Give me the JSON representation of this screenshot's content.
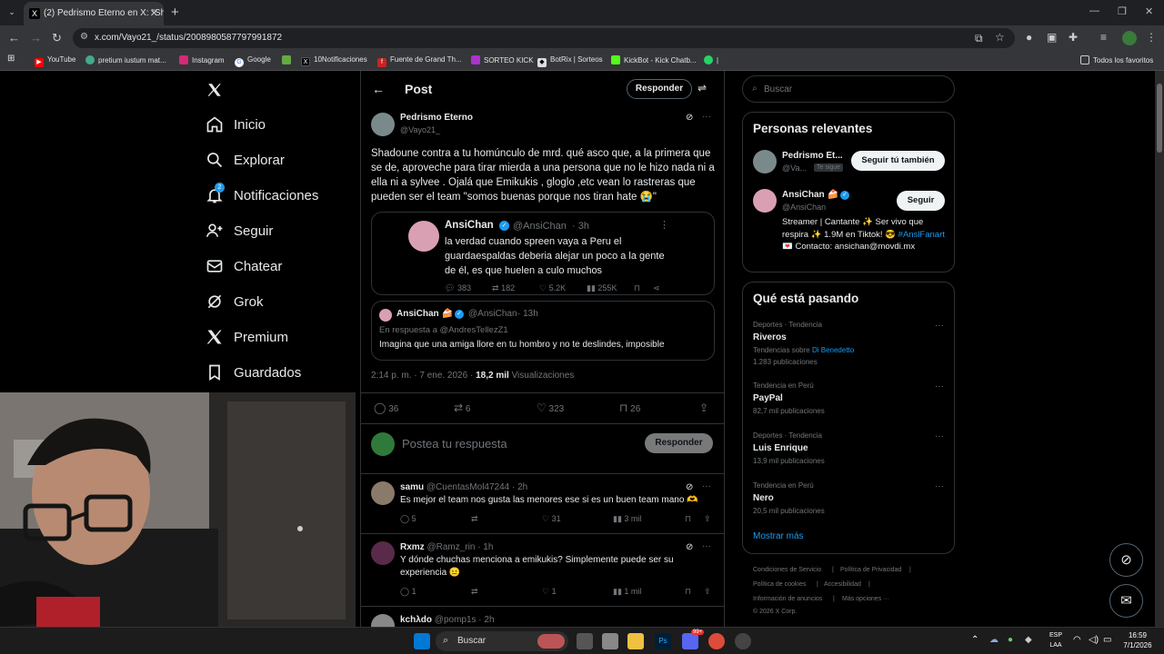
{
  "browser": {
    "tab_title": "(2) Pedrismo Eterno en X: \"Shad",
    "url": "x.com/Vayo21_/status/2008980587797991872",
    "bookmarks": [
      "YouTube",
      "pretium iustum mat...",
      "Instagram",
      "Google",
      "10Notificaciones",
      "Fuente de Grand Th...",
      "SORTEO KICK",
      "BotRix | Sorteos",
      "KickBot - Kick Chatb...",
      "|"
    ],
    "all_bookmarks": "Todos los favoritos"
  },
  "nav": {
    "items": [
      {
        "label": "Inicio",
        "icon": "home-icon"
      },
      {
        "label": "Explorar",
        "icon": "search-icon"
      },
      {
        "label": "Notificaciones",
        "icon": "bell-icon",
        "badge": "2"
      },
      {
        "label": "Seguir",
        "icon": "follow-icon"
      },
      {
        "label": "Chatear",
        "icon": "mail-icon"
      },
      {
        "label": "Grok",
        "icon": "grok-icon"
      },
      {
        "label": "Premium",
        "icon": "x-logo-icon"
      },
      {
        "label": "Guardados",
        "icon": "bookmark-icon"
      }
    ]
  },
  "post_header": {
    "title": "Post",
    "reply_button": "Responder"
  },
  "post": {
    "author_name": "Pedrismo Eterno",
    "author_handle": "@Vayo21_",
    "text": "Shadoune contra a tu homúnculo de mrd. qué asco que, a la primera que se de, aproveche para tirar mierda a una persona que no le hizo nada ni a ella ni a sylvee . Ojalá que Emikukis , gloglo ,etc vean lo rastreras que pueden ser el team \"somos buenas porque nos tiran hate 😭\"",
    "quote": {
      "name": "AnsiChan",
      "handle": "@AnsiChan",
      "time": "· 3h",
      "text": "la verdad cuando spreen vaya a Peru el guardaespaldas deberia alejar un poco a la gente de él, es que huelen a culo muchos",
      "replies": "383",
      "reposts": "182",
      "likes": "5.2K",
      "views": "255K"
    },
    "nested_quote": {
      "name": "AnsiChan 🍰",
      "handle": "@AnsiChan",
      "time": "· 13h",
      "reply_to": "En respuesta a @AndresTellezZ1",
      "text": "Imagina que una amiga llore en tu hombro y no te deslindes, imposible"
    },
    "timestamp": "2:14 p. m. · 7 ene. 2026 ·",
    "views_count": "18,2 mil",
    "views_label": "Visualizaciones",
    "replies": "36",
    "reposts": "6",
    "likes": "323",
    "bookmarks": "26"
  },
  "composer": {
    "placeholder": "Postea tu respuesta",
    "button": "Responder"
  },
  "replies": [
    {
      "name": "samu",
      "handle": "@CuentasMol47244 · 2h",
      "text": "Es mejor el team nos gusta las menores ese si es un buen team mano 🫶",
      "replies": "5",
      "reposts": "",
      "likes": "31",
      "views": "3 mil"
    },
    {
      "name": "Rxmz",
      "handle": "@Ramz_rin · 1h",
      "text": "Y dónde chuchas menciona a emikukis? Simplemente puede ser su experiencia 😐",
      "replies": "1",
      "reposts": "",
      "likes": "1",
      "views": "1 mil"
    },
    {
      "name": "kchλdo",
      "handle": "@pomp1s · 2h",
      "text": "",
      "replies": "",
      "reposts": "",
      "likes": "",
      "views": ""
    }
  ],
  "sidebar": {
    "search_placeholder": "Buscar",
    "relevant_title": "Personas relevantes",
    "people": [
      {
        "name": "Pedrismo Et...",
        "handle": "@Va...",
        "follows_you": "Te sigue",
        "button": "Seguir tú también",
        "bio": ""
      },
      {
        "name": "AnsiChan 🍰",
        "handle": "@AnsiChan",
        "follows_you": "",
        "button": "Seguir",
        "bio": "Streamer | Cantante ✨ Ser vivo que respira ✨ 1.9M en Tiktok! 😎",
        "bio_tag": "#AnslFanart",
        "bio_tail": "💌 Contacto: ansichan@movdi.mx"
      }
    ],
    "trending_title": "Qué está pasando",
    "trends": [
      {
        "category": "Deportes · Tendencia",
        "name": "Riveros",
        "extra_prefix": "Tendencias sobre",
        "extra_link": "Di Benedetto",
        "posts": "1.283 publicaciones"
      },
      {
        "category": "Tendencia en Perú",
        "name": "PayPal",
        "extra_prefix": "",
        "extra_link": "",
        "posts": "82,7 mil publicaciones"
      },
      {
        "category": "Deportes · Tendencia",
        "name": "Luis Enrique",
        "extra_prefix": "",
        "extra_link": "",
        "posts": "13,9 mil publicaciones"
      },
      {
        "category": "Tendencia en Perú",
        "name": "Nero",
        "extra_prefix": "",
        "extra_link": "",
        "posts": "20,5 mil publicaciones"
      }
    ],
    "show_more": "Mostrar más",
    "footer": [
      "Condiciones de Servicio",
      "|",
      "Política de Privacidad",
      "|",
      "Política de cookies",
      "|",
      "Accesibilidad",
      "|",
      "Información de anuncios",
      "|",
      "Más opciones ···",
      "© 2026 X Corp."
    ]
  },
  "taskbar": {
    "search": "Buscar",
    "lang_top": "ESP",
    "lang_bottom": "LAA",
    "time": "16:59",
    "date": "7/1/2026",
    "discord_badge": "99+"
  },
  "colors": {
    "accent": "#1d9bf0",
    "background": "#000000",
    "border": "#2f3336",
    "muted": "#71767b"
  }
}
